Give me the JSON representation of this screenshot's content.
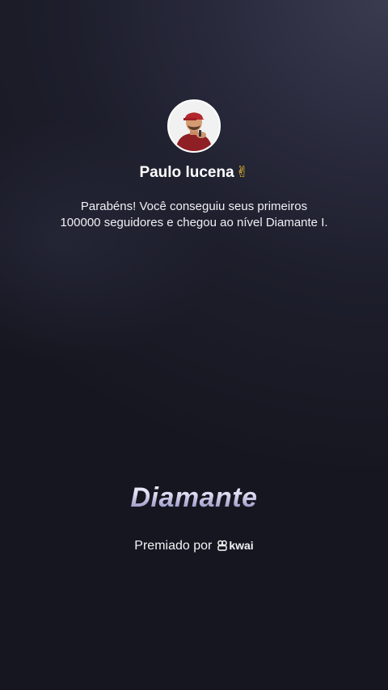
{
  "profile": {
    "name": "Paulo lucena",
    "name_emoji": "✌",
    "avatar": "profile-photo"
  },
  "message": {
    "line1": "Parabéns! Você conseguiu seus primeiros",
    "line2": "100000 seguidores e chegou ao nível Diamante I."
  },
  "badge": {
    "title": "Diamante"
  },
  "footer": {
    "awarded_by": "Premiado por",
    "brand_icon": "kwai-logo-icon",
    "brand": "kwai"
  },
  "colors": {
    "background": "#1d1e2b",
    "badge_text": "#c9c8e6"
  }
}
